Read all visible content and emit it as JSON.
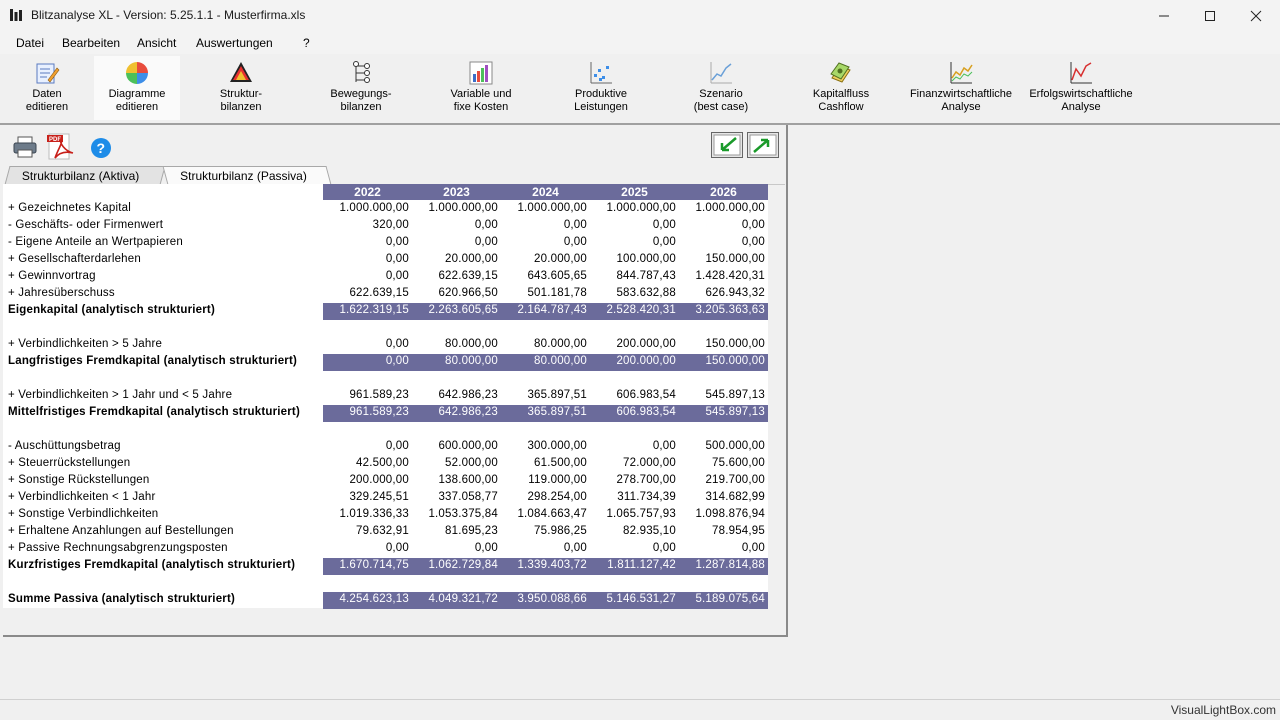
{
  "window": {
    "title": "Blitzanalyse XL - Version: 5.25.1.1 - Musterfirma.xls"
  },
  "menu": [
    "Datei",
    "Bearbeiten",
    "Ansicht",
    "Auswertungen",
    "?"
  ],
  "toolbar": [
    {
      "label": "Daten\neditieren",
      "icon": "edit-data-icon"
    },
    {
      "label": "Diagramme\neditieren",
      "icon": "edit-diagram-icon"
    },
    {
      "label": "Struktur-\nbilanzen",
      "icon": "pyramid-icon"
    },
    {
      "label": "Bewegungs-\nbilanzen",
      "icon": "tree-icon"
    },
    {
      "label": "Variable und\nfixe Kosten",
      "icon": "bar-chart-icon"
    },
    {
      "label": "Produktive\nLeistungen",
      "icon": "scatter-chart-icon"
    },
    {
      "label": "Szenario\n(best case)",
      "icon": "line-chart-icon"
    },
    {
      "label": "Kapitalfluss\nCashflow",
      "icon": "money-icon"
    },
    {
      "label": "Finanzwirtschaftliche\nAnalyse",
      "icon": "finance-chart-icon"
    },
    {
      "label": "Erfolgswirtschaftliche\nAnalyse",
      "icon": "success-chart-icon"
    }
  ],
  "tabs": {
    "aktiva": "Strukturbilanz (Aktiva)",
    "passiva": "Strukturbilanz (Passiva)"
  },
  "years": [
    "2022",
    "2023",
    "2024",
    "2025",
    "2026"
  ],
  "rows": [
    {
      "label": "+ Gezeichnetes Kapital",
      "values": [
        "1.000.000,00",
        "1.000.000,00",
        "1.000.000,00",
        "1.000.000,00",
        "1.000.000,00"
      ],
      "total": false
    },
    {
      "label": "- Geschäfts- oder Firmenwert",
      "values": [
        "320,00",
        "0,00",
        "0,00",
        "0,00",
        "0,00"
      ],
      "total": false
    },
    {
      "label": "- Eigene Anteile an Wertpapieren",
      "values": [
        "0,00",
        "0,00",
        "0,00",
        "0,00",
        "0,00"
      ],
      "total": false
    },
    {
      "label": "+ Gesellschafterdarlehen",
      "values": [
        "0,00",
        "20.000,00",
        "20.000,00",
        "100.000,00",
        "150.000,00"
      ],
      "total": false
    },
    {
      "label": "+ Gewinnvortrag",
      "values": [
        "0,00",
        "622.639,15",
        "643.605,65",
        "844.787,43",
        "1.428.420,31"
      ],
      "total": false
    },
    {
      "label": "+ Jahresüberschuss",
      "values": [
        "622.639,15",
        "620.966,50",
        "501.181,78",
        "583.632,88",
        "626.943,32"
      ],
      "total": false
    },
    {
      "label": "Eigenkapital (analytisch strukturiert)",
      "values": [
        "1.622.319,15",
        "2.263.605,65",
        "2.164.787,43",
        "2.528.420,31",
        "3.205.363,63"
      ],
      "total": true
    },
    {
      "label": "",
      "values": [
        "",
        "",
        "",
        "",
        ""
      ],
      "total": false
    },
    {
      "label": "+ Verbindlichkeiten > 5 Jahre",
      "values": [
        "0,00",
        "80.000,00",
        "80.000,00",
        "200.000,00",
        "150.000,00"
      ],
      "total": false
    },
    {
      "label": "Langfristiges Fremdkapital  (analytisch strukturiert)",
      "values": [
        "0,00",
        "80.000,00",
        "80.000,00",
        "200.000,00",
        "150.000,00"
      ],
      "total": true
    },
    {
      "label": "",
      "values": [
        "",
        "",
        "",
        "",
        ""
      ],
      "total": false
    },
    {
      "label": "+ Verbindlichkeiten > 1 Jahr und < 5 Jahre",
      "values": [
        "961.589,23",
        "642.986,23",
        "365.897,51",
        "606.983,54",
        "545.897,13"
      ],
      "total": false
    },
    {
      "label": "Mittelfristiges Fremdkapital  (analytisch strukturiert)",
      "values": [
        "961.589,23",
        "642.986,23",
        "365.897,51",
        "606.983,54",
        "545.897,13"
      ],
      "total": true
    },
    {
      "label": "",
      "values": [
        "",
        "",
        "",
        "",
        ""
      ],
      "total": false
    },
    {
      "label": "- Auschüttungsbetrag",
      "values": [
        "0,00",
        "600.000,00",
        "300.000,00",
        "0,00",
        "500.000,00"
      ],
      "total": false
    },
    {
      "label": "+ Steuerrückstellungen",
      "values": [
        "42.500,00",
        "52.000,00",
        "61.500,00",
        "72.000,00",
        "75.600,00"
      ],
      "total": false
    },
    {
      "label": "+ Sonstige Rückstellungen",
      "values": [
        "200.000,00",
        "138.600,00",
        "119.000,00",
        "278.700,00",
        "219.700,00"
      ],
      "total": false
    },
    {
      "label": "+ Verbindlichkeiten < 1 Jahr",
      "values": [
        "329.245,51",
        "337.058,77",
        "298.254,00",
        "311.734,39",
        "314.682,99"
      ],
      "total": false
    },
    {
      "label": "+ Sonstige Verbindlichkeiten",
      "values": [
        "1.019.336,33",
        "1.053.375,84",
        "1.084.663,47",
        "1.065.757,93",
        "1.098.876,94"
      ],
      "total": false
    },
    {
      "label": "+ Erhaltene Anzahlungen auf Bestellungen",
      "values": [
        "79.632,91",
        "81.695,23",
        "75.986,25",
        "82.935,10",
        "78.954,95"
      ],
      "total": false
    },
    {
      "label": "+ Passive Rechnungsabgrenzungsposten",
      "values": [
        "0,00",
        "0,00",
        "0,00",
        "0,00",
        "0,00"
      ],
      "total": false
    },
    {
      "label": "Kurzfristiges Fremdkapital  (analytisch strukturiert)",
      "values": [
        "1.670.714,75",
        "1.062.729,84",
        "1.339.403,72",
        "1.811.127,42",
        "1.287.814,88"
      ],
      "total": true
    },
    {
      "label": "",
      "values": [
        "",
        "",
        "",
        "",
        ""
      ],
      "total": false
    },
    {
      "label": "Summe Passiva (analytisch strukturiert)",
      "values": [
        "4.254.623,13",
        "4.049.321,72",
        "3.950.088,66",
        "5.146.531,27",
        "5.189.075,64"
      ],
      "total": true
    }
  ],
  "status": {
    "watermark": "VisualLightBox.com"
  }
}
